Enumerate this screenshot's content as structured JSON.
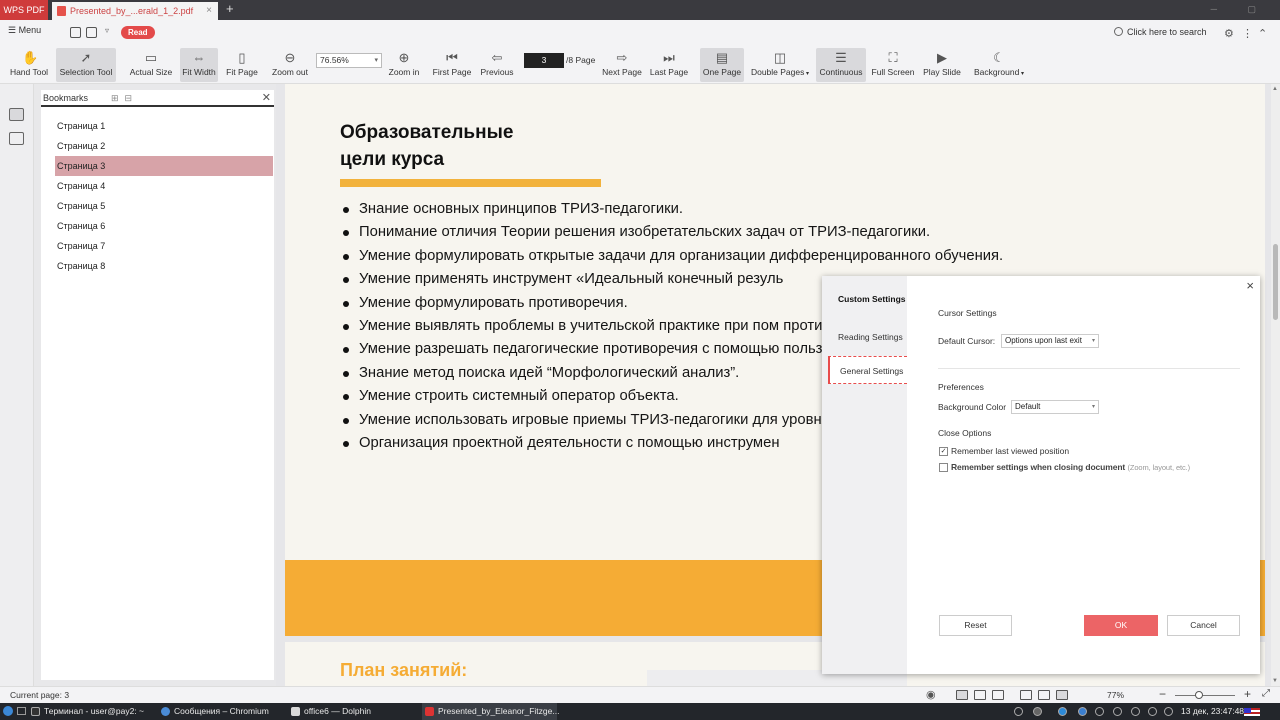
{
  "tabbar": {
    "app_label": "WPS PDF",
    "document_tab": "Presented_by_...erald_1_2.pdf",
    "close_glyph": "×",
    "new_tab_glyph": "+"
  },
  "menubar": {
    "menu_label": "Menu",
    "read_label": "Read",
    "search_label": "Click here to search"
  },
  "toolbar": {
    "hand_tool": "Hand Tool",
    "selection_tool": "Selection Tool",
    "actual_size": "Actual Size",
    "fit_width": "Fit Width",
    "fit_page": "Fit Page",
    "zoom_out": "Zoom out",
    "zoom_value": "76.56%",
    "zoom_in": "Zoom in",
    "first_page": "First Page",
    "previous": "Previous",
    "page_number": "3",
    "page_total": "/8 Page",
    "next_page": "Next Page",
    "last_page": "Last Page",
    "one_page": "One Page",
    "double_pages": "Double Pages",
    "continuous": "Continuous",
    "full_screen": "Full Screen",
    "play_slide": "Play Slide",
    "background": "Background"
  },
  "bookmarks": {
    "title": "Bookmarks",
    "items": [
      "Страница 1",
      "Страница 2",
      "Страница 3",
      "Страница 4",
      "Страница 5",
      "Страница 6",
      "Страница 7",
      "Страница 8"
    ],
    "selected_index": 2
  },
  "document": {
    "title_line1": "Образовательные",
    "title_line2": "цели курса",
    "bullets": [
      "Знание основных принципов ТРИЗ-педагогики.",
      "Понимание отличия Теории решения изобретательских задач от ТРИЗ-педагогики.",
      "Умение формулировать открытые задачи для организации дифференцированного обучения.",
      "Умение применять инструмент «Идеальный конечный резуль",
      "Умение формулировать противоречия.",
      "Умение выявлять проблемы в учительской практике при пом противоречия, ИКР.",
      "Умение разрешать педагогические противоречия с помощью пользу, сделай наоборот и др.",
      "Знание метод поиска идей “Морфологический анализ”.",
      "Умение строить системный оператор объекта.",
      "Умение использовать игровые приемы ТРИЗ-педагогики для уровня.",
      "Организация проектной деятельности с помощью инструмен"
    ],
    "next_page_title": "План занятий:"
  },
  "dialog": {
    "nav": {
      "custom": "Custom Settings",
      "reading": "Reading Settings",
      "general": "General Settings"
    },
    "cursor_settings": "Cursor Settings",
    "default_cursor_label": "Default Cursor:",
    "default_cursor_value": "Options upon last exit",
    "preferences": "Preferences",
    "background_color_label": "Background Color",
    "background_color_value": "Default",
    "close_options": "Close Options",
    "remember_position": "Remember last viewed position",
    "remember_position_checked": true,
    "remember_settings": "Remember settings when closing document",
    "remember_settings_hint": "(Zoom, layout, etc.)",
    "remember_settings_checked": false,
    "reset": "Reset",
    "ok": "OK",
    "cancel": "Cancel",
    "close_glyph": "×"
  },
  "statusbar": {
    "current_page": "Current page: 3",
    "zoom": "77%"
  },
  "taskbar": {
    "items": [
      "Терминал - user@pay2: ~",
      "Сообщения – Chromium",
      "office6 — Dolphin",
      "Presented_by_Eleanor_Fitzge..."
    ],
    "clock": "13 дек, 23:47:48"
  },
  "colors": {
    "accent_red": "#e34a4a",
    "orange": "#f5ac35",
    "bookmark_selected": "#d7a3a8"
  }
}
